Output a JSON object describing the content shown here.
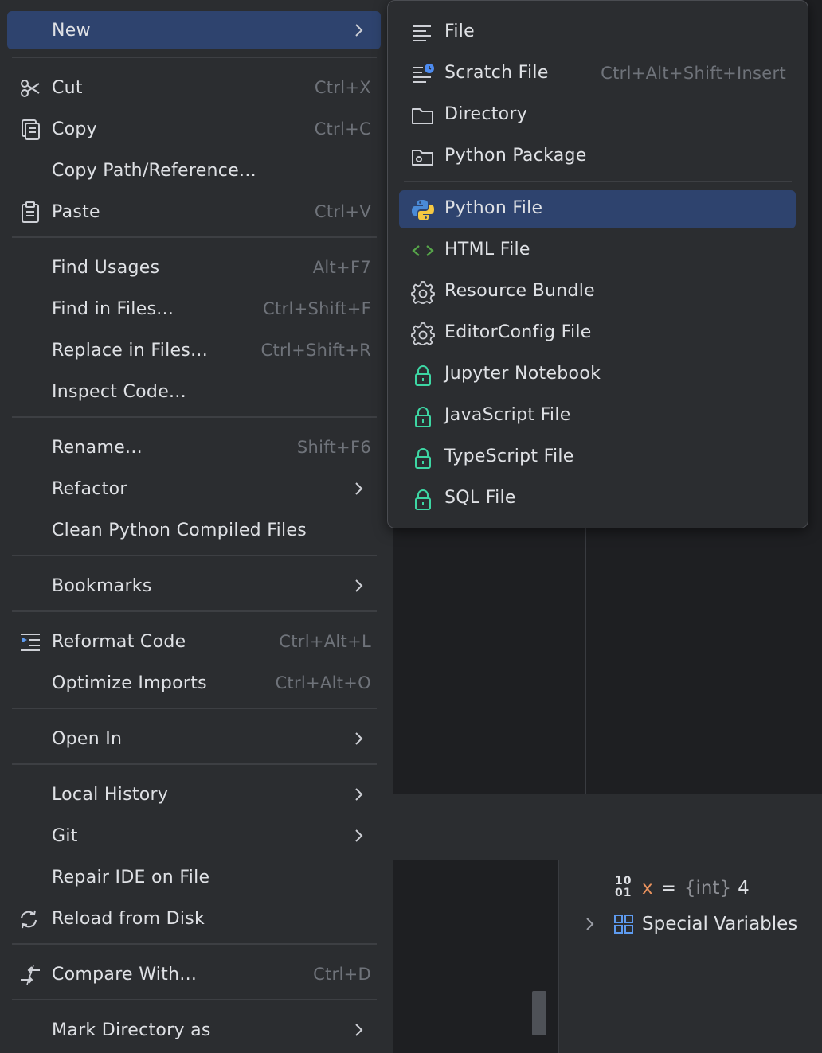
{
  "context_menu": {
    "items": [
      {
        "label": "New",
        "shortcut": "",
        "icon": "none",
        "submenu": true
      },
      {
        "label": "Cut",
        "shortcut": "Ctrl+X",
        "icon": "scissors-icon"
      },
      {
        "label": "Copy",
        "shortcut": "Ctrl+C",
        "icon": "copy-icon"
      },
      {
        "label": "Copy Path/Reference...",
        "shortcut": ""
      },
      {
        "label": "Paste",
        "shortcut": "Ctrl+V",
        "icon": "clipboard-icon"
      },
      {
        "label": "Find Usages",
        "shortcut": "Alt+F7"
      },
      {
        "label": "Find in Files...",
        "shortcut": "Ctrl+Shift+F"
      },
      {
        "label": "Replace in Files...",
        "shortcut": "Ctrl+Shift+R"
      },
      {
        "label": "Inspect Code...",
        "shortcut": ""
      },
      {
        "label": "Rename...",
        "shortcut": "Shift+F6"
      },
      {
        "label": "Refactor",
        "shortcut": "",
        "submenu": true
      },
      {
        "label": "Clean Python Compiled Files",
        "shortcut": ""
      },
      {
        "label": "Bookmarks",
        "shortcut": "",
        "submenu": true
      },
      {
        "label": "Reformat Code",
        "shortcut": "Ctrl+Alt+L",
        "icon": "reformat-icon"
      },
      {
        "label": "Optimize Imports",
        "shortcut": "Ctrl+Alt+O"
      },
      {
        "label": "Open In",
        "shortcut": "",
        "submenu": true
      },
      {
        "label": "Local History",
        "shortcut": "",
        "submenu": true
      },
      {
        "label": "Git",
        "shortcut": "",
        "submenu": true
      },
      {
        "label": "Repair IDE on File",
        "shortcut": ""
      },
      {
        "label": "Reload from Disk",
        "shortcut": "",
        "icon": "reload-icon"
      },
      {
        "label": "Compare With...",
        "shortcut": "Ctrl+D",
        "icon": "compare-icon"
      },
      {
        "label": "Mark Directory as",
        "shortcut": "",
        "submenu": true
      }
    ]
  },
  "new_submenu": {
    "items": [
      {
        "label": "File",
        "shortcut": "",
        "icon": "text-file-icon"
      },
      {
        "label": "Scratch File",
        "shortcut": "Ctrl+Alt+Shift+Insert",
        "icon": "scratch-file-icon"
      },
      {
        "label": "Directory",
        "shortcut": "",
        "icon": "folder-icon"
      },
      {
        "label": "Python Package",
        "shortcut": "",
        "icon": "package-folder-icon"
      },
      {
        "label": "Python File",
        "shortcut": "",
        "icon": "python-icon"
      },
      {
        "label": "HTML File",
        "shortcut": "",
        "icon": "html-brackets-icon"
      },
      {
        "label": "Resource Bundle",
        "shortcut": "",
        "icon": "gear-icon"
      },
      {
        "label": "EditorConfig File",
        "shortcut": "",
        "icon": "gear-icon"
      },
      {
        "label": "Jupyter Notebook",
        "shortcut": "",
        "icon": "lock-icon"
      },
      {
        "label": "JavaScript File",
        "shortcut": "",
        "icon": "lock-icon"
      },
      {
        "label": "TypeScript File",
        "shortcut": "",
        "icon": "lock-icon"
      },
      {
        "label": "SQL File",
        "shortcut": "",
        "icon": "lock-icon"
      }
    ]
  },
  "variables_panel": {
    "var_icon_top": "10",
    "var_icon_bottom": "01",
    "var_name": "x",
    "var_eq": "=",
    "var_type": "{int}",
    "var_value": "4",
    "special_label": "Special Variables"
  },
  "colors": {
    "menu_bg": "#2b2d30",
    "selection": "#2e436e",
    "text": "#dfe1e5",
    "shortcut": "#6f737a",
    "lock_green": "#3dd6a3",
    "html_green": "#57a64a"
  }
}
